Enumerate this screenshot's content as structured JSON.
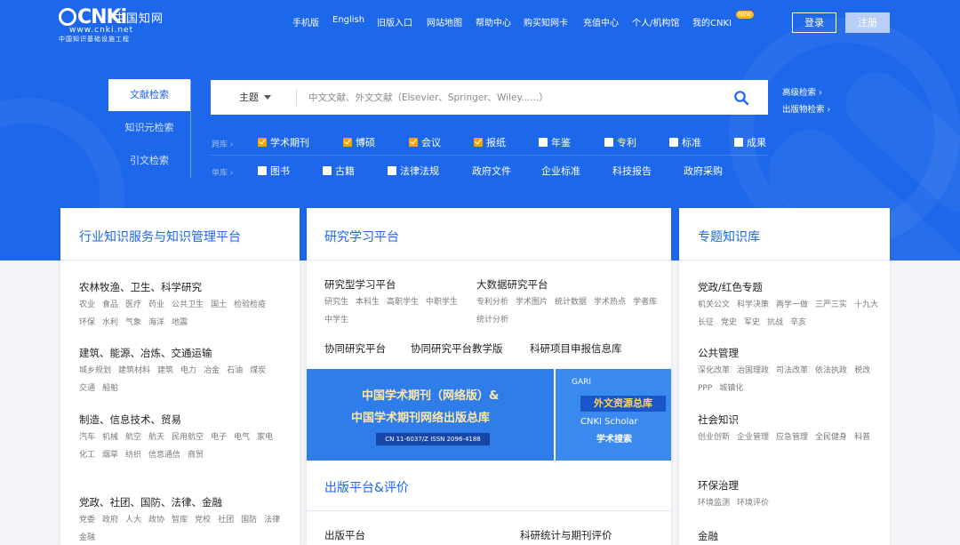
{
  "logo": {
    "mark": "CNKi",
    "cn": "中国知网",
    "url": "www.cnki.net",
    "sub": "中国知识基础设施工程"
  },
  "nav": {
    "items": [
      "手机版",
      "English",
      "旧版入口",
      "网站地图",
      "帮助中心",
      "购买知网卡",
      "充值中心",
      "个人/机构馆",
      "我的CNKI"
    ],
    "new_badge": "NEW",
    "login": "登录",
    "register": "注册"
  },
  "side_tabs": [
    "文献检索",
    "知识元检索",
    "引文检索"
  ],
  "search": {
    "field": "主题",
    "placeholder": "中文文献、外文文献（Elsevier、Springer、Wiley......）",
    "advanced": "高级检索 ›",
    "publication": "出版物检索 ›"
  },
  "filters": {
    "cross_label": "跨库 ›",
    "single_label": "单库 ›",
    "cross": [
      {
        "label": "学术期刊",
        "checked": true
      },
      {
        "label": "博硕",
        "checked": true
      },
      {
        "label": "会议",
        "checked": true
      },
      {
        "label": "报纸",
        "checked": true
      },
      {
        "label": "年鉴",
        "checked": false
      },
      {
        "label": "专利",
        "checked": false
      },
      {
        "label": "标准",
        "checked": false
      },
      {
        "label": "成果",
        "checked": false
      }
    ],
    "single": [
      {
        "label": "图书",
        "checkbox": true
      },
      {
        "label": "古籍",
        "checkbox": true
      },
      {
        "label": "法律法规",
        "checkbox": true
      },
      {
        "label": "政府文件",
        "checkbox": false
      },
      {
        "label": "企业标准",
        "checkbox": false
      },
      {
        "label": "科技报告",
        "checkbox": false
      },
      {
        "label": "政府采购",
        "checkbox": false
      }
    ]
  },
  "left_panel": {
    "title": "行业知识服务与知识管理平台",
    "categories": [
      {
        "title": "农林牧渔、卫生、科学研究",
        "links": [
          "农业",
          "食品",
          "医疗",
          "药业",
          "公共卫生",
          "国土",
          "检验检疫",
          "环保",
          "水利",
          "气象",
          "海洋",
          "地震"
        ]
      },
      {
        "title": "建筑、能源、冶炼、交通运输",
        "links": [
          "城乡规划",
          "建筑材料",
          "建筑",
          "电力",
          "冶金",
          "石油",
          "煤炭",
          "交通",
          "船舶"
        ]
      },
      {
        "title": "制造、信息技术、贸易",
        "links": [
          "汽车",
          "机械",
          "航空",
          "航天",
          "民用航空",
          "电子",
          "电气",
          "家电",
          "化工",
          "烟草",
          "纺织",
          "信息通信",
          "商贸"
        ]
      },
      {
        "title": "党政、社团、国防、法律、金融",
        "links": [
          "党委",
          "政府",
          "人大",
          "政协",
          "智库",
          "党校",
          "社团",
          "国防",
          "法律",
          "金融"
        ]
      }
    ]
  },
  "mid_panel": {
    "title": "研究学习平台",
    "blocks": [
      {
        "title": "研究型学习平台",
        "links": [
          "研究生",
          "本科生",
          "高职学生",
          "中职学生",
          "中学生"
        ]
      },
      {
        "title": "大数据研究平台",
        "links": [
          "专利分析",
          "学术图片",
          "统计数据",
          "学术热点",
          "学者库",
          "统计分析"
        ]
      }
    ],
    "row_links": [
      "协同研究平台",
      "协同研究平台教学版",
      "科研项目申报信息库"
    ],
    "banner_left": {
      "line1": "中国学术期刊（网络版）&",
      "line2": "中国学术期刊网络出版总库",
      "issn": "CN 11-6037/Z   ISSN 2096-4188"
    },
    "banner_right": {
      "gari": "GARI",
      "r1": "外文资源总库",
      "r2": "CNKI Scholar",
      "r3": "学术搜索"
    },
    "section2_title": "出版平台&评价",
    "bottom": [
      "出版平台",
      "科研统计与期刊评价"
    ]
  },
  "right_panel": {
    "title": "专题知识库",
    "categories": [
      {
        "title": "党政/红色专题",
        "links": [
          "机关公文",
          "科学决策",
          "两学一做",
          "三严三实",
          "十九大",
          "长征",
          "党史",
          "军史",
          "抗战",
          "辛亥"
        ]
      },
      {
        "title": "公共管理",
        "links": [
          "深化改革",
          "治国理政",
          "司法改革",
          "依法执政",
          "税改",
          "PPP",
          "城镇化"
        ]
      },
      {
        "title": "社会知识",
        "links": [
          "创业创新",
          "企业管理",
          "应急管理",
          "全民健身",
          "科普"
        ]
      },
      {
        "title": "环保治理",
        "links": [
          "环境监测",
          "环境评价"
        ]
      },
      {
        "title": "金融",
        "links": []
      }
    ]
  },
  "colors": {
    "brand": "#1c67ea",
    "checkbox_on": "#f4a11a"
  }
}
